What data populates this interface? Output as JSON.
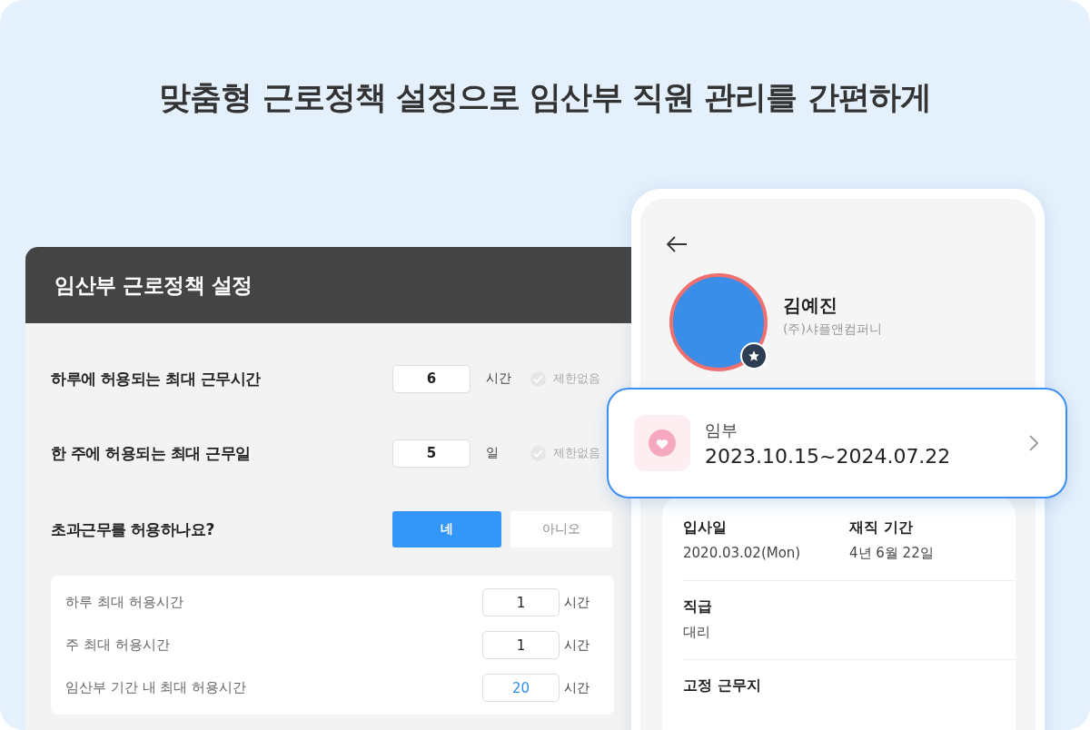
{
  "headline": "맞춤형 근로정책 설정으로 임산부 직원 관리를 간편하게",
  "settings_panel": {
    "title": "임산부 근로정책 설정",
    "limits": [
      {
        "label": "하루에 허용되는 최대 근무시간",
        "value": "6",
        "unit": "시간",
        "no_limit_label": "제한없음",
        "no_limit_checked": false
      },
      {
        "label": "한 주에 허용되는 최대 근무일",
        "value": "5",
        "unit": "일",
        "no_limit_label": "제한없음",
        "no_limit_checked": false
      }
    ],
    "overtime": {
      "question": "초과근무를 허용하나요?",
      "options": [
        {
          "label": "네",
          "selected": true
        },
        {
          "label": "아니오",
          "selected": false
        }
      ]
    },
    "overtime_limits": [
      {
        "label": "하루 최대 허용시간",
        "value": "1",
        "unit": "시간",
        "highlighted": false
      },
      {
        "label": "주 최대 허용시간",
        "value": "1",
        "unit": "시간",
        "highlighted": false
      },
      {
        "label": "임산부 기간 내 최대 허용시간",
        "value": "20",
        "unit": "시간",
        "highlighted": true
      }
    ]
  },
  "profile": {
    "name": "김예진",
    "company": "(주)샤플앤컴퍼니",
    "status_card": {
      "type": "임부",
      "period": "2023.10.15~2024.07.22"
    },
    "detail_sections": [
      {
        "fields": [
          {
            "label": "입사일",
            "value": "2020.03.02(Mon)"
          },
          {
            "label": "재직 기간",
            "value": "4년 6월 22일"
          }
        ]
      },
      {
        "fields": [
          {
            "label": "직급",
            "value": "대리"
          }
        ]
      },
      {
        "fields": [
          {
            "label": "고정 근무지"
          }
        ]
      }
    ]
  }
}
